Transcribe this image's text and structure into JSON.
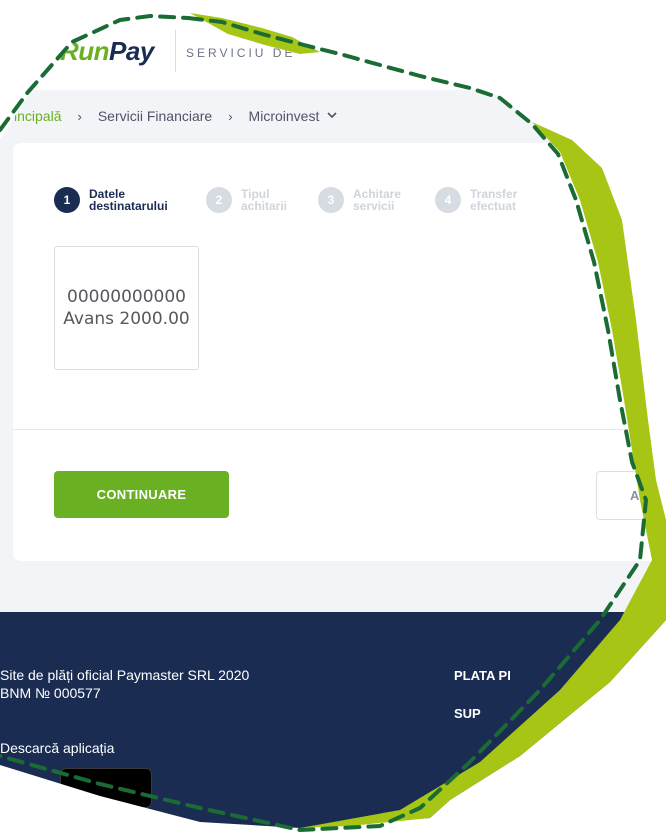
{
  "header": {
    "logo_part1": "Run",
    "logo_part2": "Pay",
    "tagline": "SERVICIU DE"
  },
  "breadcrumb": {
    "items": [
      "Principală",
      "Servicii Financiare",
      "Microinvest"
    ],
    "separator": "›",
    "dropdown_icon": "chevron-down-icon"
  },
  "stepper": {
    "steps": [
      {
        "number": "1",
        "line1": "Datele",
        "line2": "destinatarului",
        "state": "active"
      },
      {
        "number": "2",
        "line1": "Tipul",
        "line2": "achitarii",
        "state": "inactive"
      },
      {
        "number": "3",
        "line1": "Achitare",
        "line2": "servicii",
        "state": "inactive"
      },
      {
        "number": "4",
        "line1": "Transfer",
        "line2": "efectuat",
        "state": "inactive"
      }
    ]
  },
  "account": {
    "number": "00000000000",
    "label": "Avans 2000.00"
  },
  "actions": {
    "continue_label": "CONTINUARE",
    "cancel_label": "A"
  },
  "footer": {
    "line1": "Site de plăți oficial Paymaster SRL 2020",
    "line2": "BNM № 000577",
    "app_label": "Descarcă aplicația",
    "nav1": "PLATA PI",
    "nav2": "SUP"
  },
  "colors": {
    "brand_green": "#6ab023",
    "brand_navy": "#1b2c52",
    "overlay_lime": "#a6c515",
    "dashed_outline": "#1a6b34"
  }
}
